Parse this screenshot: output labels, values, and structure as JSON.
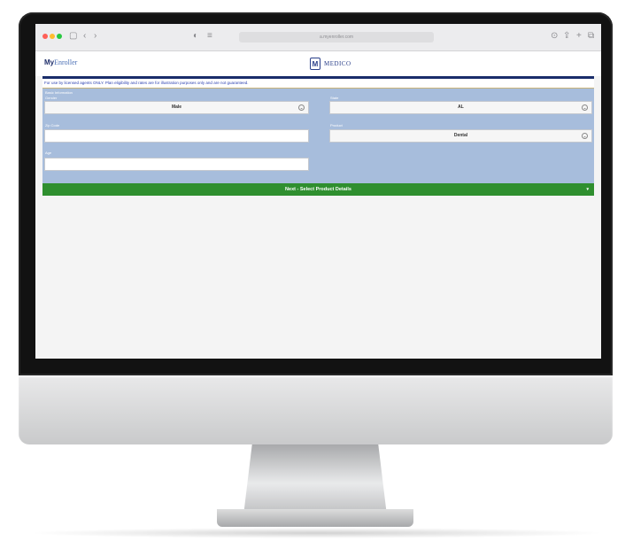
{
  "browser": {
    "url": "a.myenroller.com",
    "icons": [
      "sidebar-icon",
      "back-icon",
      "forward-icon",
      "privacy-icon",
      "reader-icon",
      "download-icon",
      "share-icon",
      "new-tab-icon",
      "tabs-icon"
    ]
  },
  "header": {
    "logo_prefix": "My",
    "logo_suffix": "Enroller",
    "partner_mark": "M",
    "partner_name": "MEDICO"
  },
  "notice": "For use by licensed agents ONLY. Plan eligibility and rates are for illustration purposes only and are not guaranteed.",
  "form": {
    "section_title": "Basic Information",
    "gender": {
      "label": "Gender",
      "value": "Male"
    },
    "state": {
      "label": "State",
      "value": "AL"
    },
    "zip": {
      "label": "Zip Code",
      "value": ""
    },
    "product": {
      "label": "Product",
      "value": "Dental"
    },
    "age": {
      "label": "Age",
      "value": ""
    },
    "next_button": "Next - Select Product Details"
  },
  "colors": {
    "form_bg": "#a7bddc",
    "next_button": "#2f8f2f",
    "rule": "#1a2d6a",
    "notice_text": "#2a3fb0"
  }
}
